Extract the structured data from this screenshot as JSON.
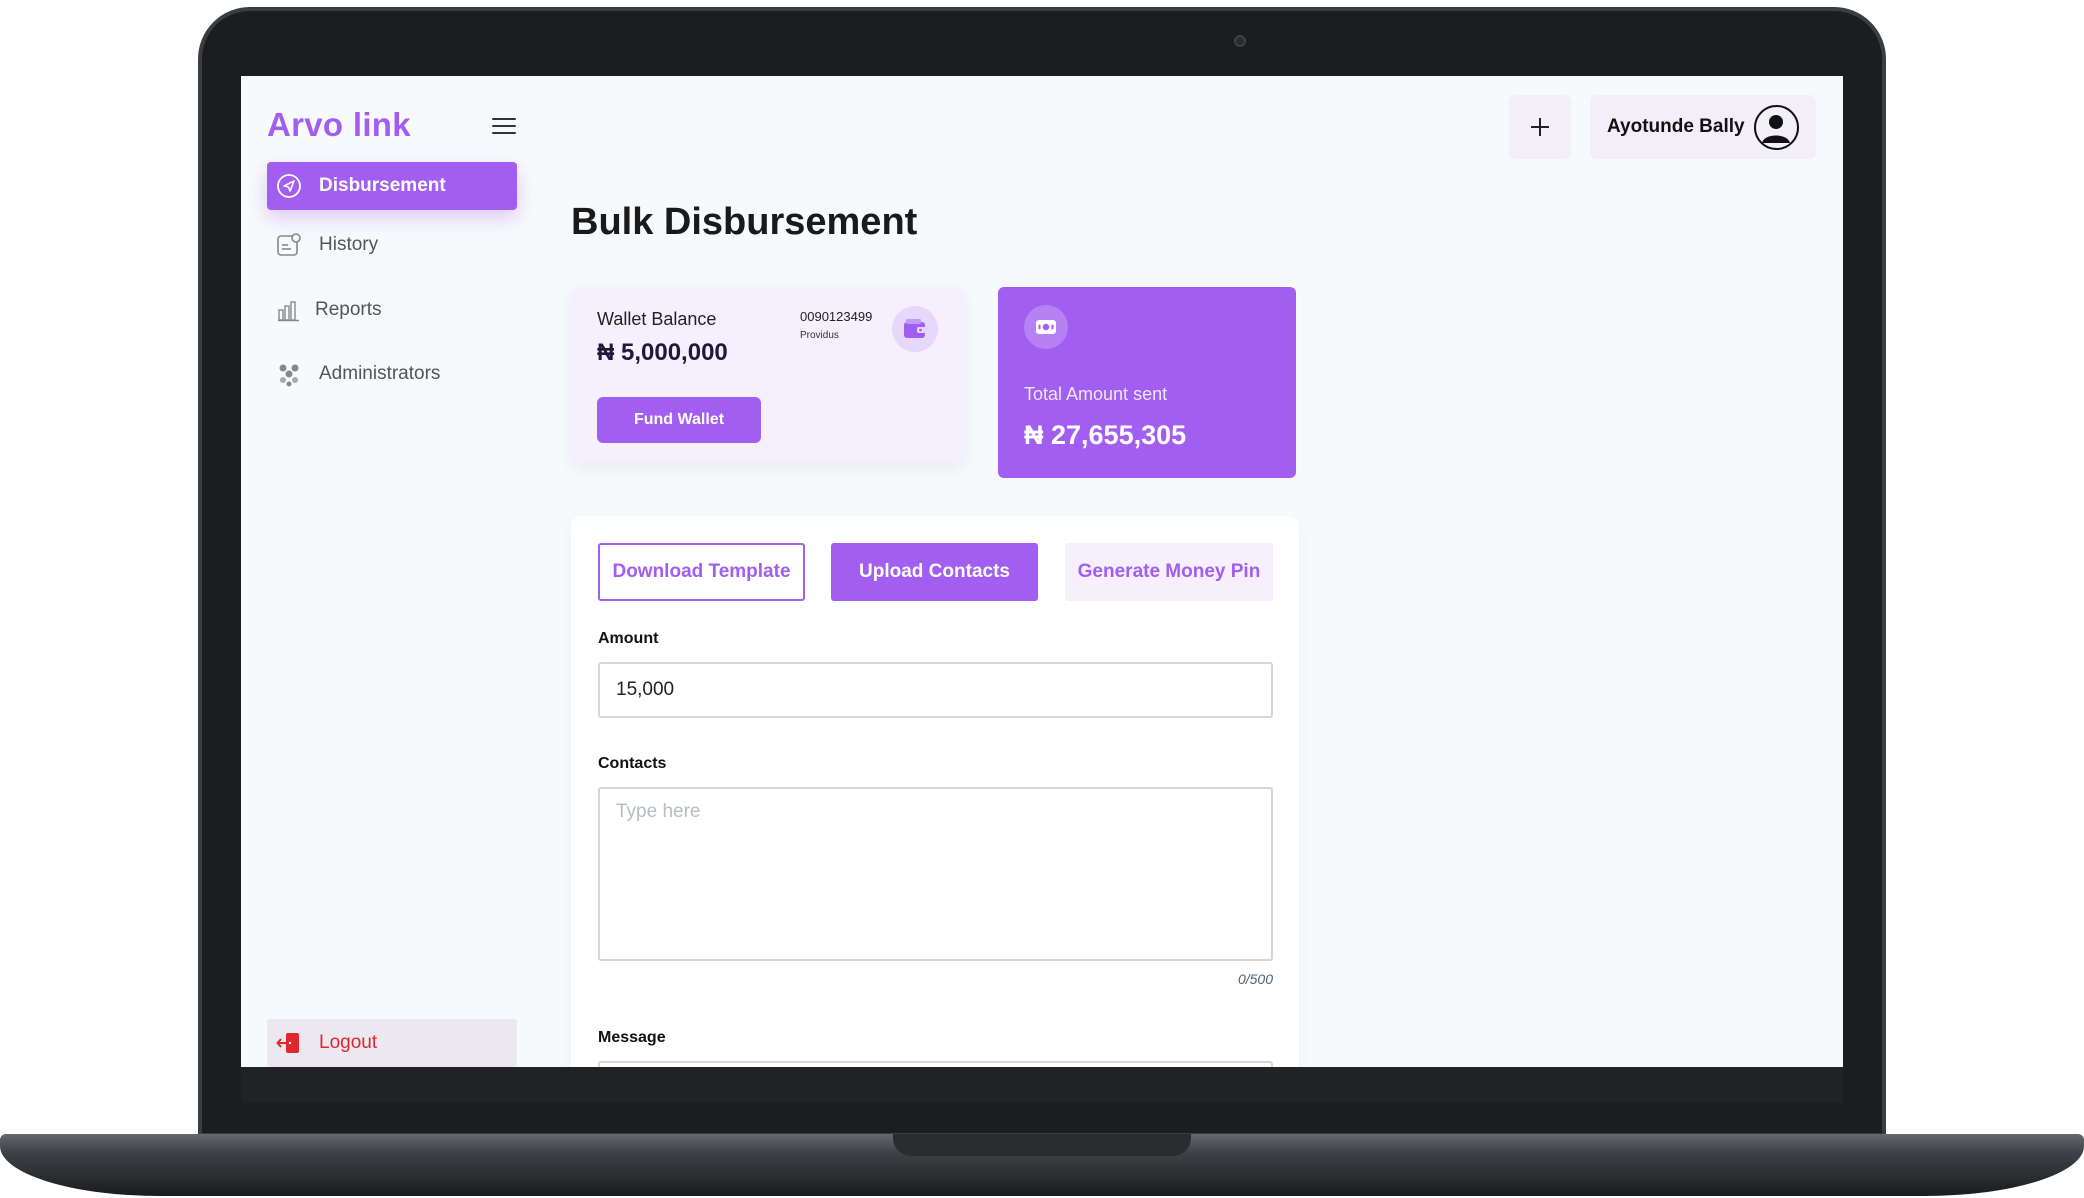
{
  "app": {
    "brand": "Arvo link",
    "page_title": "Bulk Disbursement"
  },
  "header": {
    "add_label": "+",
    "user_name": "Ayotunde Bally"
  },
  "sidebar": {
    "items": [
      {
        "label": "Disbursement",
        "icon": "send-icon",
        "active": true
      },
      {
        "label": "History",
        "icon": "history-icon",
        "active": false
      },
      {
        "label": "Reports",
        "icon": "bar-chart-icon",
        "active": false
      },
      {
        "label": "Administrators",
        "icon": "users-icon",
        "active": false
      }
    ],
    "logout_label": "Logout"
  },
  "wallet": {
    "label": "Wallet Balance",
    "amount": "₦ 5,000,000",
    "account_number": "0090123499",
    "bank": "Providus",
    "fund_label": "Fund Wallet"
  },
  "total": {
    "label": "Total Amount sent",
    "amount": "₦ 27,655,305"
  },
  "form": {
    "tabs": [
      {
        "label": "Download Template",
        "style": "outline"
      },
      {
        "label": "Upload Contacts",
        "style": "filled"
      },
      {
        "label": "Generate Money Pin",
        "style": "soft"
      }
    ],
    "amount_label": "Amount",
    "amount_value": "15,000",
    "contacts_label": "Contacts",
    "contacts_placeholder": "Type here",
    "contacts_counter": "0/500",
    "message_label": "Message"
  },
  "colors": {
    "accent": "#a15ef0",
    "accent_soft": "#f6effd",
    "logout": "#e0262f",
    "background": "#f7fafc"
  }
}
